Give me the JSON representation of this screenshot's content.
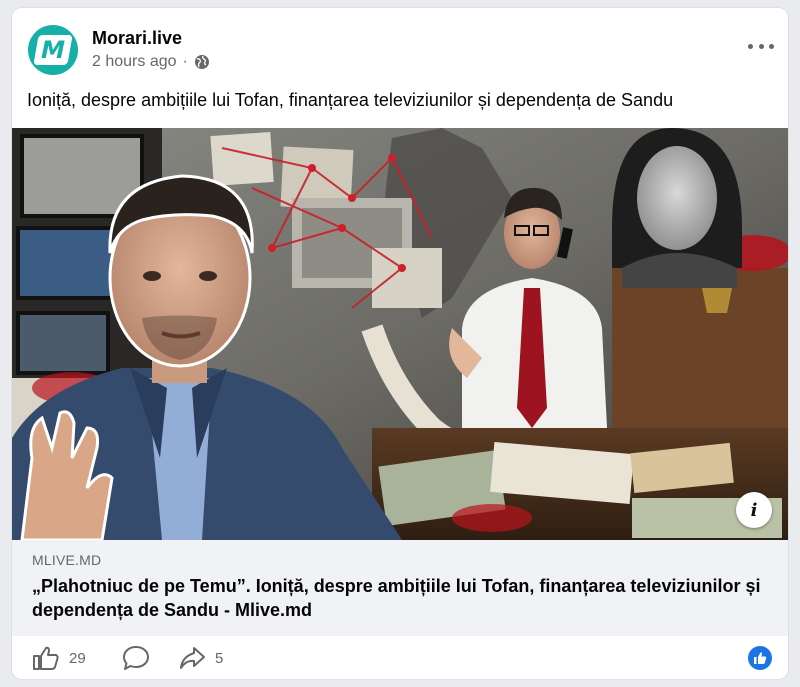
{
  "post": {
    "page_name": "Morari.live",
    "avatar_letter": "M",
    "timestamp": "2 hours ago",
    "separator": "·",
    "text": "Ioniță, despre ambițiile lui Tofan, finanțarea televiziunilor și dependența de Sandu"
  },
  "link": {
    "domain": "MLIVE.MD",
    "title": "„Plahotniuc de pe Temu”. Ioniță, despre ambițiile lui Tofan, finanțarea televiziunilor și dependența de Sandu - Mlive.md",
    "info_icon": "i"
  },
  "actions": {
    "like_count": "29",
    "share_count": "5"
  },
  "colors": {
    "brand_teal": "#17b0a8",
    "like_blue": "#1b74e4",
    "meta_gray": "#65676b"
  },
  "icons": [
    "globe-icon",
    "more-icon",
    "info-icon",
    "like-icon",
    "comment-icon",
    "share-icon",
    "like-reaction-icon"
  ]
}
